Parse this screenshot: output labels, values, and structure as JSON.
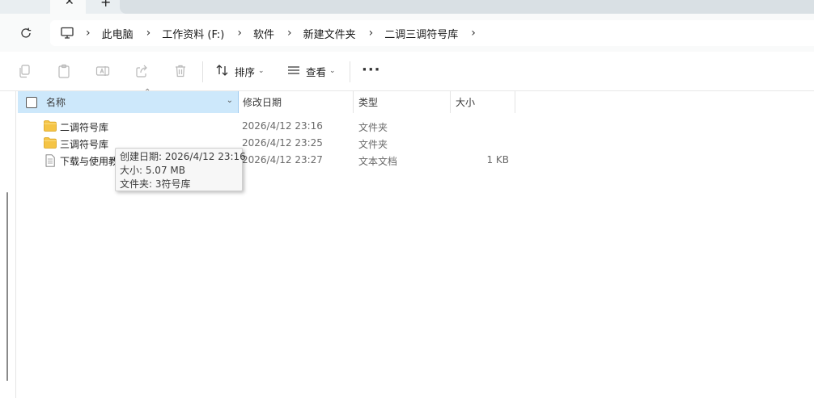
{
  "tabbar": {
    "close_glyph": "✕",
    "new_glyph": "+"
  },
  "breadcrumb": [
    "此电脑",
    "工作资料 (F:)",
    "软件",
    "新建文件夹",
    "二调三调符号库"
  ],
  "commands": {
    "sort_label": "排序",
    "view_label": "查看",
    "more_label": "···"
  },
  "columns": {
    "name": "名称",
    "modified": "修改日期",
    "type": "类型",
    "size": "大小"
  },
  "files": [
    {
      "icon": "folder-icon",
      "name": "二调符号库",
      "modified": "2026/4/12 23:16",
      "type": "文件夹",
      "size": ""
    },
    {
      "icon": "folder-icon",
      "name": "三调符号库",
      "modified": "2026/4/12 23:25",
      "type": "文件夹",
      "size": ""
    },
    {
      "icon": "text-file-icon",
      "name": "下载与使用教",
      "modified": "2026/4/12 23:27",
      "type": "文本文档",
      "size": "1 KB"
    }
  ],
  "tooltip": {
    "created": "创建日期: 2026/4/12 23:16",
    "size": "大小: 5.07 MB",
    "folders": "文件夹: 3符号库"
  },
  "colors": {
    "header_selected": "#cde8fb",
    "folder": "#f5c445",
    "tab_bg": "#e9eef1"
  }
}
